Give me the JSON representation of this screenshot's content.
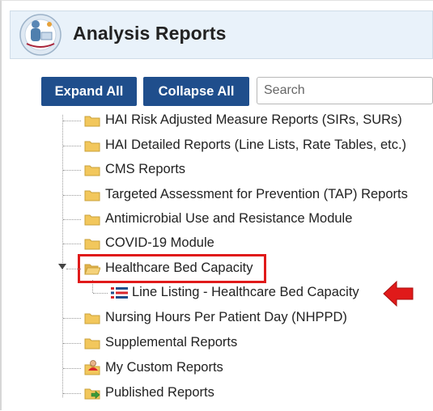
{
  "header": {
    "title": "Analysis Reports",
    "logo_icon": "analysis-reports-logo"
  },
  "toolbar": {
    "expand_all_label": "Expand All",
    "collapse_all_label": "Collapse All",
    "search_placeholder": "Search"
  },
  "tree": {
    "items": [
      {
        "label": "HAI Risk Adjusted Measure Reports (SIRs, SURs)",
        "icon": "folder-icon"
      },
      {
        "label": "HAI Detailed Reports (Line Lists, Rate Tables, etc.)",
        "icon": "folder-icon"
      },
      {
        "label": "CMS Reports",
        "icon": "folder-icon"
      },
      {
        "label": "Targeted Assessment for Prevention (TAP) Reports",
        "icon": "folder-icon"
      },
      {
        "label": "Antimicrobial Use and Resistance Module",
        "icon": "folder-icon"
      },
      {
        "label": "COVID-19 Module",
        "icon": "folder-icon"
      },
      {
        "label": "Healthcare Bed Capacity",
        "icon": "folder-open-icon",
        "expanded": true,
        "highlighted": true
      },
      {
        "label": "Line Listing - Healthcare Bed Capacity",
        "icon": "line-list-report-icon",
        "child": true
      },
      {
        "label": "Nursing Hours Per Patient Day (NHPPD)",
        "icon": "folder-icon"
      },
      {
        "label": "Supplemental Reports",
        "icon": "folder-icon"
      },
      {
        "label": "My Custom Reports",
        "icon": "custom-reports-folder-icon"
      },
      {
        "label": "Published Reports",
        "icon": "published-reports-folder-icon"
      }
    ]
  },
  "colors": {
    "button_bg": "#1f4e8c",
    "header_bg": "#e9f2fa",
    "highlight": "#e01a1a",
    "folder": "#f2c75c"
  }
}
